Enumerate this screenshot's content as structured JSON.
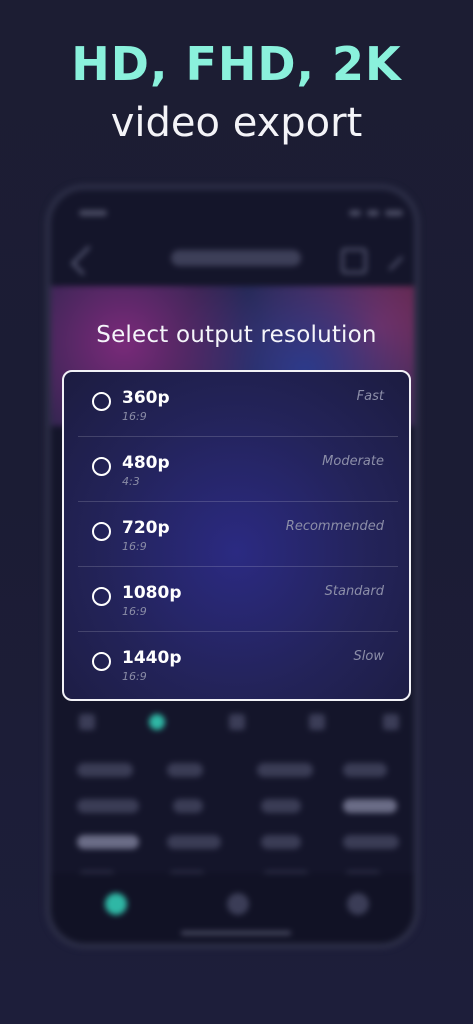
{
  "header": {
    "headline": "HD, FHD, 2K",
    "subheadline": "video export"
  },
  "dialog": {
    "title": "Select output resolution",
    "options": [
      {
        "resolution": "360p",
        "ratio": "16:9",
        "speed": "Fast"
      },
      {
        "resolution": "480p",
        "ratio": "4:3",
        "speed": "Moderate"
      },
      {
        "resolution": "720p",
        "ratio": "16:9",
        "speed": "Recommended"
      },
      {
        "resolution": "1080p",
        "ratio": "16:9",
        "speed": "Standard"
      },
      {
        "resolution": "1440p",
        "ratio": "16:9",
        "speed": "Slow"
      }
    ],
    "selected_index": null
  },
  "colors": {
    "accent": "#8af1dc",
    "background": "#1c1d33",
    "panel": "#232359",
    "active_tool": "#2fb7a5"
  },
  "background_phone": {
    "icons": [
      "back-icon",
      "crop-icon",
      "check-icon"
    ]
  }
}
